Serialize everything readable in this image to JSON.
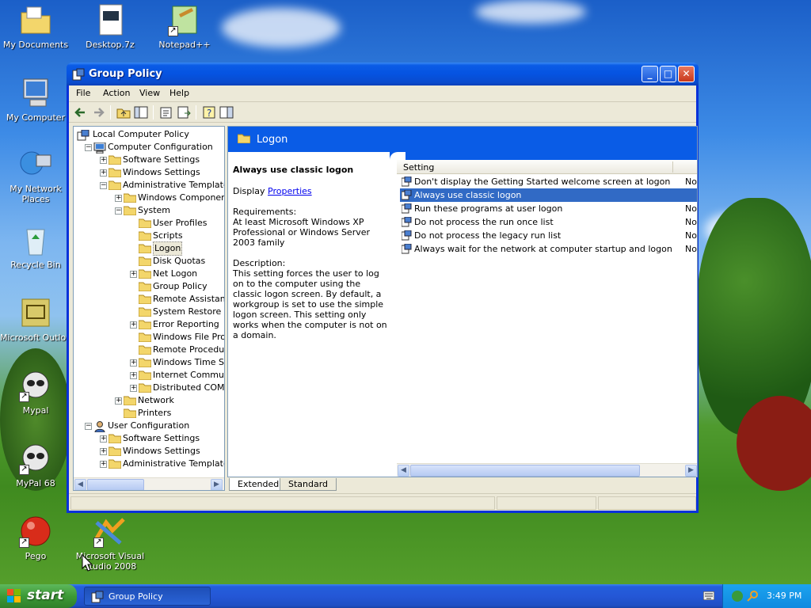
{
  "desktop": {
    "icons": [
      {
        "label": "My Documents"
      },
      {
        "label": "Desktop.7z"
      },
      {
        "label": "Notepad++"
      },
      {
        "label": "My Computer"
      },
      {
        "label": "My Network Places"
      },
      {
        "label": "Recycle Bin"
      },
      {
        "label": "Microsoft Outloo"
      },
      {
        "label": "Mypal"
      },
      {
        "label": "MyPal 68"
      },
      {
        "label": "Pego"
      },
      {
        "label": "Microsoft Visual Studio 2008"
      }
    ]
  },
  "window": {
    "title": "Group Policy",
    "controls": {
      "minimize": "_",
      "maximize": "□",
      "close": "✕"
    }
  },
  "menu": {
    "file": "File",
    "action": "Action",
    "view": "View",
    "help": "Help"
  },
  "tree": {
    "items": [
      {
        "label": "Local Computer Policy"
      },
      {
        "label": "Computer Configuration"
      },
      {
        "label": "Software Settings"
      },
      {
        "label": "Windows Settings"
      },
      {
        "label": "Administrative Templates"
      },
      {
        "label": "Windows Components"
      },
      {
        "label": "System"
      },
      {
        "label": "User Profiles"
      },
      {
        "label": "Scripts"
      },
      {
        "label": "Logon"
      },
      {
        "label": "Disk Quotas"
      },
      {
        "label": "Net Logon"
      },
      {
        "label": "Group Policy"
      },
      {
        "label": "Remote Assistance"
      },
      {
        "label": "System Restore"
      },
      {
        "label": "Error Reporting"
      },
      {
        "label": "Windows File Prote"
      },
      {
        "label": "Remote Procedure"
      },
      {
        "label": "Windows Time Serv"
      },
      {
        "label": "Internet Communic"
      },
      {
        "label": "Distributed COM"
      },
      {
        "label": "Network"
      },
      {
        "label": "Printers"
      },
      {
        "label": "User Configuration"
      },
      {
        "label": "Software Settings"
      },
      {
        "label": "Windows Settings"
      },
      {
        "label": "Administrative Templates"
      }
    ]
  },
  "details": {
    "header": "Logon",
    "policy_title": "Always use classic logon",
    "display_label": "Display",
    "display_link": "Properties",
    "requirements_label": "Requirements:",
    "requirements": "At least Microsoft Windows XP Professional or Windows Server 2003 family",
    "description_label": "Description:",
    "description": "This setting forces the user to log on to the computer using the classic logon screen. By default, a workgroup is set to use the simple logon screen. This setting only works when the computer is not on a domain."
  },
  "settings": {
    "column_setting": "Setting",
    "rows": [
      {
        "name": "Don't display the Getting Started welcome screen at logon",
        "state": "Not"
      },
      {
        "name": "Always use classic logon",
        "state": ""
      },
      {
        "name": "Run these programs at user logon",
        "state": "Not"
      },
      {
        "name": "Do not process the run once list",
        "state": "Not"
      },
      {
        "name": "Do not process the legacy run list",
        "state": "Not"
      },
      {
        "name": "Always wait for the network at computer startup and logon",
        "state": "Not"
      }
    ]
  },
  "tabs": {
    "extended": "Extended",
    "standard": "Standard"
  },
  "taskbar": {
    "start": "start",
    "task": "Group Policy",
    "clock": "3:49 PM"
  }
}
